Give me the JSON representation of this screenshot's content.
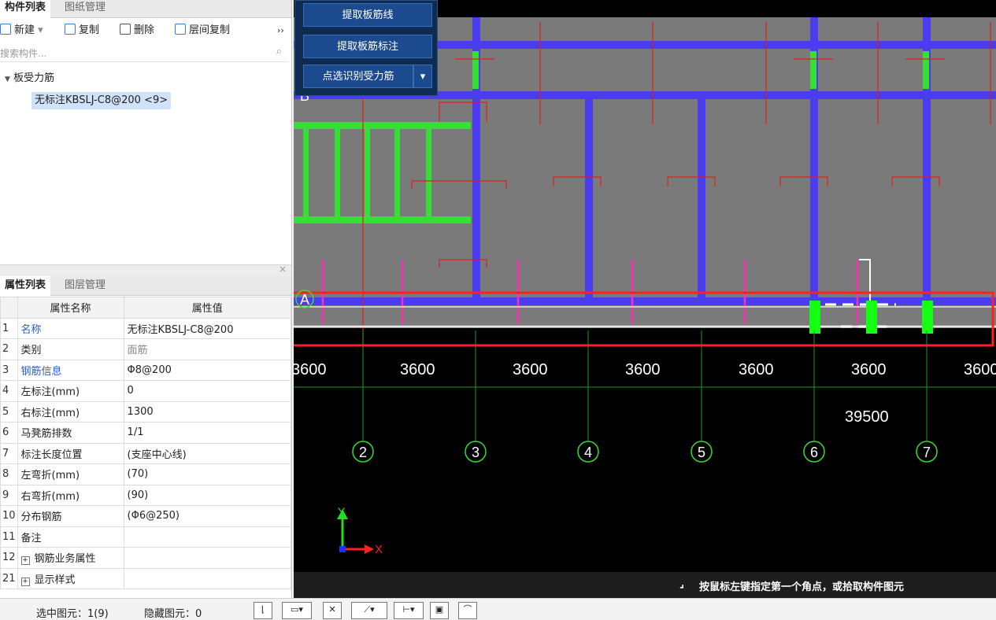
{
  "top_panel": {
    "tabs": [
      "构件列表",
      "图纸管理"
    ],
    "toolbar": {
      "new": "新建",
      "copy": "复制",
      "delete": "删除",
      "layer_copy": "层间复制",
      "more": "››"
    },
    "search_placeholder": "搜索构件...",
    "tree_root": "板受力筋",
    "tree_item": "无标注KBSLJ-C8@200 <9>"
  },
  "props_panel": {
    "tabs": [
      "属性列表",
      "图层管理"
    ],
    "headers": [
      "属性名称",
      "属性值"
    ],
    "rows": [
      {
        "n": "1",
        "name": "名称",
        "value": "无标注KBSLJ-C8@200",
        "nameBlue": true,
        "valueGray": false
      },
      {
        "n": "2",
        "name": "类别",
        "value": "面筋",
        "nameBlue": false,
        "valueGray": true
      },
      {
        "n": "3",
        "name": "钢筋信息",
        "value": "Φ8@200",
        "nameBlue": true,
        "valueGray": false
      },
      {
        "n": "4",
        "name": "左标注(mm)",
        "value": "0",
        "nameBlue": false,
        "valueGray": false
      },
      {
        "n": "5",
        "name": "右标注(mm)",
        "value": "1300",
        "nameBlue": false,
        "valueGray": false
      },
      {
        "n": "6",
        "name": "马凳筋排数",
        "value": "1/1",
        "nameBlue": false,
        "valueGray": false
      },
      {
        "n": "7",
        "name": "标注长度位置",
        "value": "(支座中心线)",
        "nameBlue": false,
        "valueGray": false
      },
      {
        "n": "8",
        "name": "左弯折(mm)",
        "value": "(70)",
        "nameBlue": false,
        "valueGray": false
      },
      {
        "n": "9",
        "name": "右弯折(mm)",
        "value": "(90)",
        "nameBlue": false,
        "valueGray": false
      },
      {
        "n": "10",
        "name": "分布钢筋",
        "value": "(Φ6@250)",
        "nameBlue": false,
        "valueGray": false
      },
      {
        "n": "11",
        "name": "备注",
        "value": "",
        "nameBlue": false,
        "valueGray": false
      },
      {
        "n": "12",
        "name": "钢筋业务属性",
        "value": "",
        "nameBlue": false,
        "valueGray": false,
        "expand": true
      },
      {
        "n": "21",
        "name": "显示样式",
        "value": "",
        "nameBlue": false,
        "valueGray": false,
        "expand": true
      }
    ]
  },
  "status": {
    "selected": "选中图元：1(9)",
    "hidden": "隐藏图元：0"
  },
  "float_panel": {
    "btn1": "提取板筋线",
    "btn2": "提取板筋标注",
    "btn3": "点选识别受力筋"
  },
  "canvas": {
    "dims": [
      "3600",
      "3600",
      "3600",
      "3600",
      "3600",
      "3600",
      "3600"
    ],
    "total_dim": "39500",
    "axes": [
      "2",
      "3",
      "4",
      "5",
      "6",
      "7"
    ],
    "row_labels": [
      "A",
      "B"
    ],
    "axis_x": "X",
    "axis_y": "Y"
  },
  "hint": "按鼠标左键指定第一个角点，或拾取构件图元"
}
